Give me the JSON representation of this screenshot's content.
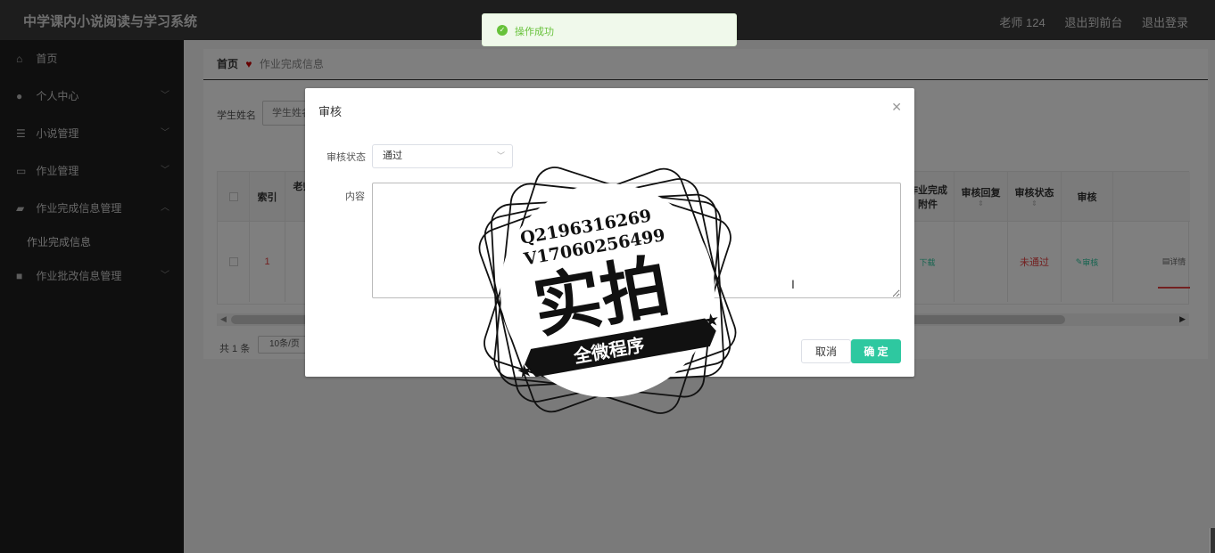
{
  "header": {
    "app_title": "中学课内小说阅读与学习系统",
    "user": "老师 124",
    "to_front": "退出到前台",
    "logout": "退出登录"
  },
  "sidebar": {
    "items": [
      {
        "label": "首页",
        "icon": "home-icon"
      },
      {
        "label": "个人中心",
        "icon": "user-icon"
      },
      {
        "label": "小说管理",
        "icon": "sliders-icon"
      },
      {
        "label": "作业管理",
        "icon": "chat-icon"
      },
      {
        "label": "作业完成信息管理",
        "icon": "briefcase-icon"
      },
      {
        "label": "作业批改信息管理",
        "icon": "comment-icon"
      }
    ],
    "sub_item": "作业完成信息"
  },
  "breadcrumb": {
    "home": "首页",
    "current": "作业完成信息"
  },
  "search": {
    "label": "学生姓名",
    "placeholder": "学生姓名"
  },
  "table": {
    "headers": {
      "index": "索引",
      "teacher": "老师",
      "attachment_a": "作业完成",
      "attachment_b": "附件",
      "reply": "审核回复",
      "status": "审核状态",
      "audit": "审核"
    },
    "row": {
      "index": "1",
      "attachment": "下载",
      "status": "未通过",
      "audit": "审核",
      "detail": "详情"
    }
  },
  "pager": {
    "total": "共 1 条",
    "page_size": "10条/页"
  },
  "toast": {
    "text": "操作成功"
  },
  "dialog": {
    "title": "审核",
    "status_label": "审核状态",
    "status_value": "通过",
    "content_label": "内容",
    "content_value": "",
    "cancel": "取消",
    "confirm": "确 定"
  },
  "watermark": {
    "qq": "Q2196316269",
    "vx": "V17060256499",
    "big": "实拍",
    "ribbon": "全微程序"
  },
  "colors": {
    "accent": "#2ec8a0",
    "success": "#67c23a",
    "danger": "#e64242",
    "header_bg": "#3a3a3a",
    "sidebar_bg": "#1f1f1f"
  }
}
